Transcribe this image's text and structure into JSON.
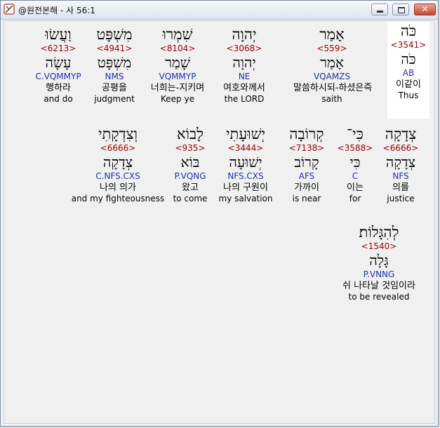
{
  "window": {
    "title": "@원전본해 - 사 56:1",
    "minimize_label": "",
    "maximize_label": "",
    "close_label": "✕"
  },
  "words": [
    {
      "heb": "כֹּה",
      "num": "<3541>",
      "lemma": "כֹּה",
      "pars": "AB",
      "kor": "이같이",
      "eng": "Thus"
    },
    {
      "heb": "אָמַר",
      "num": "<559>",
      "lemma": "אָמַר",
      "pars": "VQAMZS",
      "kor": "말씀하시되-하셨은즉",
      "eng": "saith"
    },
    {
      "heb": "יְהוָה",
      "num": "<3068>",
      "lemma": "יְהוָה",
      "pars": "NE",
      "kor": "여호와께서",
      "eng": "the LORD"
    },
    {
      "heb": "שִׁמְרוּ",
      "num": "<8104>",
      "lemma": "שָׁמַר",
      "pars": "VQMMYP",
      "kor": "너희는-지키며",
      "eng": "Keep ye"
    },
    {
      "heb": "מִשְׁפָּט",
      "num": "<4941>",
      "lemma": "מִשְׁפָּט",
      "pars": "NMS",
      "kor": "공평을",
      "eng": "judgment"
    },
    {
      "heb": "וַעֲשׂוּ",
      "num": "<6213>",
      "lemma": "עָשָׂה",
      "pars": "C.VQMMYP",
      "kor": "행하라",
      "eng": "and do"
    },
    {
      "heb": "צְדָקָה",
      "num": "<6666>",
      "lemma": "צְדָקָה",
      "pars": "NFS",
      "kor": "의를",
      "eng": "justice"
    },
    {
      "heb": "כִּי־",
      "num": "<3588>",
      "lemma": "כִּי",
      "pars": "C",
      "kor": "이는",
      "eng": "for"
    },
    {
      "heb": "קְרוֹבָה",
      "num": "<7138>",
      "lemma": "קָרוֹב",
      "pars": "AFS",
      "kor": "가까이",
      "eng": "is near"
    },
    {
      "heb": "יְשׁוּעָתִי",
      "num": "<3444>",
      "lemma": "יְשׁוּעָה",
      "pars": "NFS.CXS",
      "kor": "나의 구원이",
      "eng": "my salvation"
    },
    {
      "heb": "לָבוֹא",
      "num": "<935>",
      "lemma": "בּוֹא",
      "pars": "P.VQNG",
      "kor": "왔고",
      "eng": "to come"
    },
    {
      "heb": "וְצִדְקָתִי",
      "num": "<6666>",
      "lemma": "צְדָקָה",
      "pars": "C.NFS.CXS",
      "kor": "나의 의가",
      "eng": "and my fighteousness"
    },
    {
      "heb": "לְהִגָּלוֹת׃",
      "num": "<1540>",
      "lemma": "גָּלָה",
      "pars": "P.VNNG",
      "kor": "쉬 나타날 것임이라",
      "eng": "to be revealed"
    }
  ]
}
